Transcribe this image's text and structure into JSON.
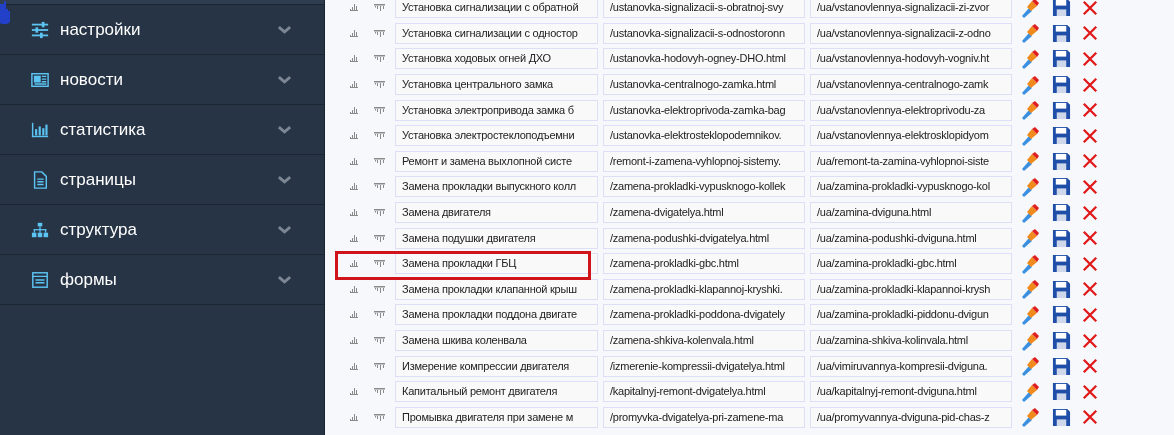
{
  "sidebar": {
    "items": [
      {
        "label": "настройки",
        "expanded": false
      },
      {
        "label": "новости",
        "expanded": false
      },
      {
        "label": "статистика",
        "expanded": false
      },
      {
        "label": "страницы",
        "expanded": false
      },
      {
        "label": "структура",
        "expanded": false
      },
      {
        "label": "формы",
        "expanded": false
      }
    ]
  },
  "table": {
    "rows": [
      {
        "title": "Установка сигнализации с обратной",
        "url": "/ustanovka-signalizacii-s-obratnoj-svy",
        "url_ua": "/ua/vstanovlennya-signalizacii-zi-zvor",
        "highlighted": false
      },
      {
        "title": "Установка сигнализации с одностор",
        "url": "/ustanovka-signalizacii-s-odnostoronn",
        "url_ua": "/ua/vstanovlennya-signalizacii-z-odno",
        "highlighted": false
      },
      {
        "title": "Установка ходовых огней ДХО",
        "url": "/ustanovka-hodovyh-ogney-DHO.html",
        "url_ua": "/ua/vstanovlennya-hodovyh-vogniv.ht",
        "highlighted": false
      },
      {
        "title": "Установка центрального замка",
        "url": "/ustanovka-centralnogo-zamka.html",
        "url_ua": "/ua/vstanovlennya-centralnogo-zamk",
        "highlighted": false
      },
      {
        "title": "Установка электропривода замка б",
        "url": "/ustanovka-elektroprivoda-zamka-bag",
        "url_ua": "/ua/vstanovlennya-elektroprivodu-za",
        "highlighted": false
      },
      {
        "title": "Установка электростеклоподъемни",
        "url": "/ustanovka-elektrosteklopodemnikov.",
        "url_ua": "/ua/vstanovlennya-elektrosklopidyom",
        "highlighted": false
      },
      {
        "title": "Ремонт и замена выхлопной систе",
        "url": "/remont-i-zamena-vyhlopnoj-sistemy.",
        "url_ua": "/ua/remont-ta-zamina-vyhlopnoi-siste",
        "highlighted": false
      },
      {
        "title": "Замена прокладки выпускного колл",
        "url": "/zamena-prokladki-vypusknogo-kollek",
        "url_ua": "/ua/zamina-prokladki-vypusknogo-kol",
        "highlighted": false
      },
      {
        "title": "Замена двигателя",
        "url": "/zamena-dvigatelya.html",
        "url_ua": "/ua/zamina-dviguna.html",
        "highlighted": false
      },
      {
        "title": "Замена подушки двигателя",
        "url": "/zamena-podushki-dvigatelya.html",
        "url_ua": "/ua/zamina-podushki-dviguna.html",
        "highlighted": false
      },
      {
        "title": "Замена прокладки ГБЦ",
        "url": "/zamena-prokladki-gbc.html",
        "url_ua": "/ua/zamina-prokladki-gbc.html",
        "highlighted": true
      },
      {
        "title": "Замена прокладки клапанной крыш",
        "url": "/zamena-prokladki-klapannoj-kryshki.",
        "url_ua": "/ua/zamina-prokladki-klapannoi-krysh",
        "highlighted": false
      },
      {
        "title": "Замена прокладки поддона двигате",
        "url": "/zamena-prokladki-poddona-dvigately",
        "url_ua": "/ua/zamina-prokladki-piddonu-dvigun",
        "highlighted": false
      },
      {
        "title": "Замена шкива коленвала",
        "url": "/zamena-shkiva-kolenvala.html",
        "url_ua": "/ua/zamina-shkiva-kolinvala.html",
        "highlighted": false
      },
      {
        "title": "Измерение компрессии двигателя",
        "url": "/izmerenie-kompressii-dvigatelya.html",
        "url_ua": "/ua/vimiruvannya-kompresii-dviguna.",
        "highlighted": false
      },
      {
        "title": "Капитальный ремонт двигателя",
        "url": "/kapitalnyj-remont-dvigatelya.html",
        "url_ua": "/ua/kapitalnyj-remont-dviguna.html",
        "highlighted": false
      },
      {
        "title": "Промывка двигателя при замене м",
        "url": "/promyvka-dvigatelya-pri-zamene-ma",
        "url_ua": "/ua/promyvannya-dviguna-pid-chas-z",
        "highlighted": false
      }
    ]
  }
}
